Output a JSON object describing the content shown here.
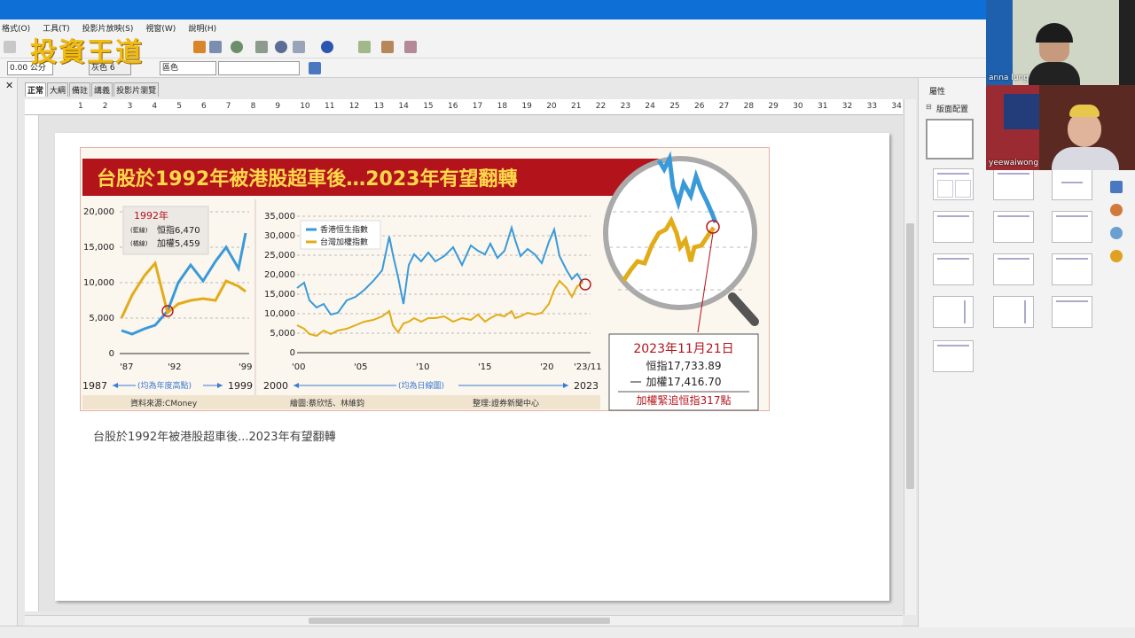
{
  "window": {
    "menu": [
      "格式(O)",
      "工具(T)",
      "投影片放映(S)",
      "視窗(W)",
      "說明(H)"
    ]
  },
  "toolbar": {
    "line_width": "0.00 公分",
    "fill_color": "灰色 6",
    "area_style": "區色"
  },
  "watermark": "投資王道",
  "view_tabs": [
    "正常",
    "大綱",
    "備註",
    "講義",
    "投影片瀏覽"
  ],
  "ruler_numbers": [
    "1",
    "2",
    "3",
    "4",
    "5",
    "6",
    "7",
    "8",
    "9",
    "10",
    "11",
    "12",
    "13",
    "14",
    "15",
    "16",
    "17",
    "18",
    "19",
    "20",
    "21",
    "22",
    "23",
    "24",
    "25",
    "26",
    "27",
    "28",
    "29",
    "30",
    "31",
    "32",
    "33",
    "34"
  ],
  "sidebar": {
    "title": "屬性",
    "section": "版面配置"
  },
  "participants": [
    {
      "name": "anna lung"
    },
    {
      "name": "yeewaiwong"
    }
  ],
  "figure": {
    "headline": "台股於1992年被港股超車後…2023年有望翻轉",
    "left_panel": {
      "y_ticks": [
        "20,000",
        "15,000",
        "10,000",
        "5,000",
        "0"
      ],
      "x_ticks": [
        "'87",
        "'92",
        "'99"
      ],
      "callout_year": "1992年",
      "callout_blue_tag": "(藍線)",
      "callout_blue_val": "恒指6,470",
      "callout_yellow_tag": "(橘線)",
      "callout_yellow_val": "加權5,459",
      "range_start": "1987",
      "range_note": "(均為年度高點)",
      "range_end": "1999"
    },
    "right_panel": {
      "y_ticks": [
        "35,000",
        "30,000",
        "25,000",
        "20,000",
        "15,000",
        "10,000",
        "5,000",
        "0"
      ],
      "x_ticks": [
        "'00",
        "'05",
        "'10",
        "'15",
        "'20",
        "'23/11"
      ],
      "legend_hk": "香港恒生指數",
      "legend_tw": "台灣加權指數",
      "range_start": "2000",
      "range_note": "(均為日線圖)",
      "range_end": "2023"
    },
    "infobox": {
      "date": "2023年11月21日",
      "hsi": "恒指17,733.89",
      "taiex": "加權17,416.70",
      "note": "加權緊追恒指317點"
    },
    "footer_source": "資料來源:CMoney",
    "footer_credit": "繪圖:蔡欣恬、林維鈞",
    "footer_editor": "整理:證券新聞中心"
  },
  "caption": "台股於1992年被港股超車後...2023年有望翻轉",
  "colors": {
    "titlebar": "#0e6fd6",
    "banner_red": "#b3141c",
    "banner_text": "#ffd84a",
    "hk_blue": "#3a9ad9",
    "tw_gold": "#e2ac18"
  }
}
